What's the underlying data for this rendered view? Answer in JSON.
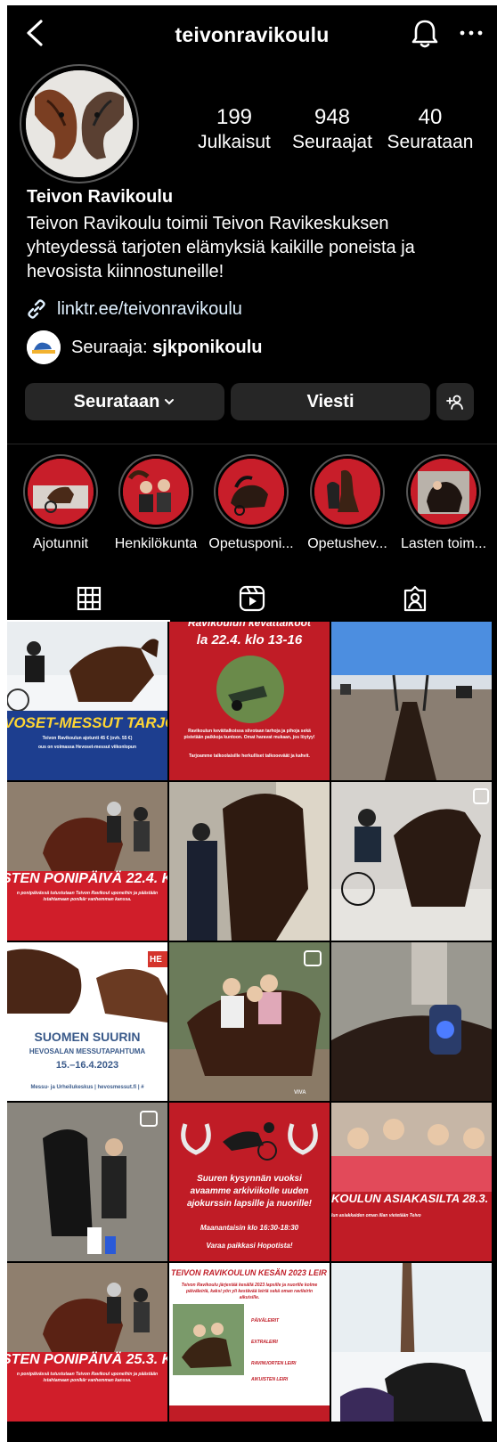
{
  "header": {
    "username": "teivonravikoulu"
  },
  "profile": {
    "display_name": "Teivon Ravikoulu",
    "bio": "Teivon Ravikoulu toimii Teivon Ravikeskuksen yhteydessä tarjoten elämyksiä kaikille poneista ja hevosista kiinnostuneille!",
    "link": "linktr.ee/teivonravikoulu",
    "followed_by_label": "Seuraaja:",
    "followed_by_user": "sjkponikoulu",
    "stats": [
      {
        "value": "199",
        "label": "Julkaisut"
      },
      {
        "value": "948",
        "label": "Seuraajat"
      },
      {
        "value": "40",
        "label": "Seurataan"
      }
    ]
  },
  "buttons": {
    "following": "Seurataan",
    "message": "Viesti"
  },
  "highlights": [
    {
      "label": "Ajotunnit"
    },
    {
      "label": "Henkilökunta"
    },
    {
      "label": "Opetusponi..."
    },
    {
      "label": "Opetushev..."
    },
    {
      "label": "Lasten toim..."
    }
  ],
  "posts": {
    "p1": {
      "headline": "VOSET-MESSUT TARJO",
      "line1": "Teivon Ravikoulun ajotunti 45 € (ovh. 55 €)",
      "line2": "ous on voimassa Hevoset-messut viikonlopun"
    },
    "p2": {
      "headline1": "Ravikoulun kevättalkoot",
      "headline2": "la 22.4. klo 13-16",
      "body": "Ravikoulun kevättalkoissa siivotaan tarhoja ja pihoja sekä pistetään paikkoja kuntoon. Omat haravat mukaan, jos löytyy!",
      "footer": "Tarjoamme talkoolaisille herkulliset talkooeväät ja kahvit."
    },
    "p4": {
      "headline": "STEN PONIPÄIVÄ 22.4. KLO",
      "body": "n ponipäivässä tutustutaan Teivon Ravikoul uponeihin ja päästään istahtamaan ponikär vanhemman kanssa."
    },
    "p7": {
      "badge": "HE",
      "title1": "SUOMEN SUURIN",
      "title2": "HEVOSALAN MESSUTAPAHTUMA",
      "dates": "15.–16.4.2023",
      "footer": "Messu- ja Urheilukeskus | hevosmessut.fi | #"
    },
    "p8": {
      "watermark": "VIVA"
    },
    "p11": {
      "line1": "Suuren kysynnän vuoksi",
      "line2": "avaamme arkiviikolle uuden",
      "line3": "ajokurssin lapsille ja nuorille!",
      "line4": "Maanantaisin klo 16:30-18:30",
      "line5": "Varaa paikkasi Hopotista!"
    },
    "p12": {
      "headline": "KOULUN ASIAKASILTA 28.3.",
      "body": "lun asiakkaiden oman illan vietetään Teivo"
    },
    "p13": {
      "headline": "STEN PONIPÄIVÄ 25.3. KLO",
      "body": "n ponipäivässä tutustutaan Teivon Ravikoul uponeihin ja päästään istahtamaan ponikär vanhemman kanssa."
    },
    "p14": {
      "headline": "TEIVON RAVIKOULUN KESÄN 2023 LEIR",
      "body": "Teivon Ravikoulu järjestää kesällä 2023 lapsille ja nuorille kolme päiväleiriä, kaksi yön yli kestävää leiriä sekä oman ravileirin aikuisille.",
      "camp1": "PÄIVÄLEIRIT",
      "camp2": "EXTRALEIRI",
      "camp3": "RAVINUORTEN LEIRI",
      "camp4": "AIKUISTEN LEIRI"
    }
  },
  "colors": {
    "background": "#000000",
    "button": "#262626",
    "accent_red": "#c81e2a",
    "link": "#e0f1ff"
  }
}
